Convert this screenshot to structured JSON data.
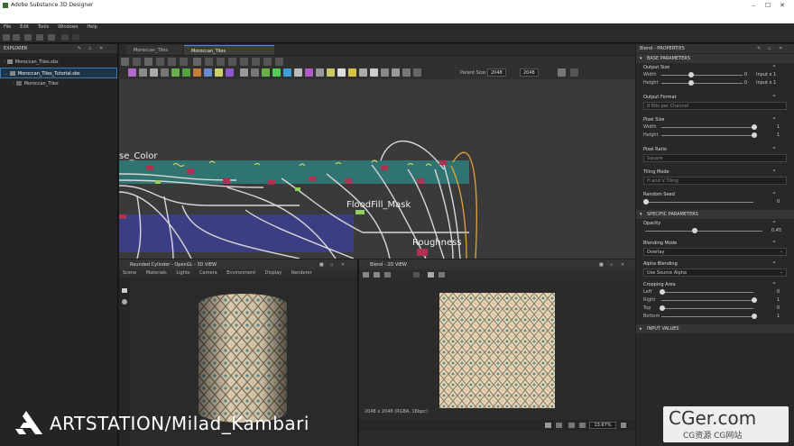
{
  "window": {
    "title": "Adobe Substance 3D Designer",
    "minimize": "–",
    "maximize": "☐",
    "close": "✕"
  },
  "menu": [
    "File",
    "Edit",
    "Tools",
    "Windows",
    "Help"
  ],
  "explorer": {
    "title": "EXPLORER",
    "items": [
      {
        "label": "Moroccan_Tiles.sbs",
        "selected": false
      },
      {
        "label": "Moroccan_Tiles_Tutorial.sbs",
        "selected": true
      },
      {
        "label": "Moroccan_Tiles",
        "selected": false
      }
    ]
  },
  "graph": {
    "tabs": [
      "Moroccan_Tiles",
      "Moroccan_Tiles"
    ],
    "parent_size_label": "Parent Size:",
    "parent_size_w": "2048",
    "parent_size_h": "2048",
    "node_labels": [
      "se_Color",
      "FloodFill_Mask",
      "Roughness"
    ]
  },
  "view3d": {
    "title": "Rounded Cylinder - OpenGL - 3D VIEW",
    "menu": [
      "Scene",
      "Materials",
      "Lights",
      "Camera",
      "Environment",
      "Display",
      "Renderer"
    ]
  },
  "view2d": {
    "title": "Blend - 2D VIEW",
    "status": "2048 x 2048 (RGBA, 16bpc)",
    "zoom": "13.67%"
  },
  "properties": {
    "title": "Blend - PROPERTIES",
    "base_section": "BASE PARAMETERS",
    "output_size": "Output Size",
    "width_label": "Width",
    "height_label": "Height",
    "output_w_val": "0",
    "output_h_val": "0",
    "input_x1": "Input x 1",
    "input_y1": "Input x 1",
    "output_format": "Output Format",
    "output_format_val": "8 Bits per Channel",
    "pixel_size": "Pixel Size",
    "pixel_w_val": "1",
    "pixel_h_val": "1",
    "pixel_ratio": "Pixel Ratio",
    "pixel_ratio_val": "Square",
    "tiling_mode": "Tiling Mode",
    "tiling_mode_val": "H and V Tiling",
    "random_seed": "Random Seed",
    "random_seed_val": "0",
    "specific_section": "SPECIFIC PARAMETERS",
    "opacity": "Opacity",
    "opacity_val": "0.45",
    "blending_mode": "Blending Mode",
    "blending_mode_val": "Overlay",
    "alpha_blending": "Alpha Blending",
    "alpha_blending_val": "Use Source Alpha",
    "cropping_area": "Cropping Area",
    "left": "Left",
    "left_val": "0",
    "right": "Right",
    "right_val": "1",
    "top": "Top",
    "top_val": "0",
    "bottom": "Bottom",
    "bottom_val": "1",
    "input_section": "INPUT VALUES"
  },
  "watermark": {
    "text": "ARTSTATION/Milad_Kambari"
  },
  "cger": {
    "line1": "CGer.com",
    "line2": "CG资源 CG网站"
  },
  "colors": {
    "teal_frame": "#2f7f7b",
    "blue_frame": "#3d3f8c",
    "selection": "#3a7bb5"
  }
}
